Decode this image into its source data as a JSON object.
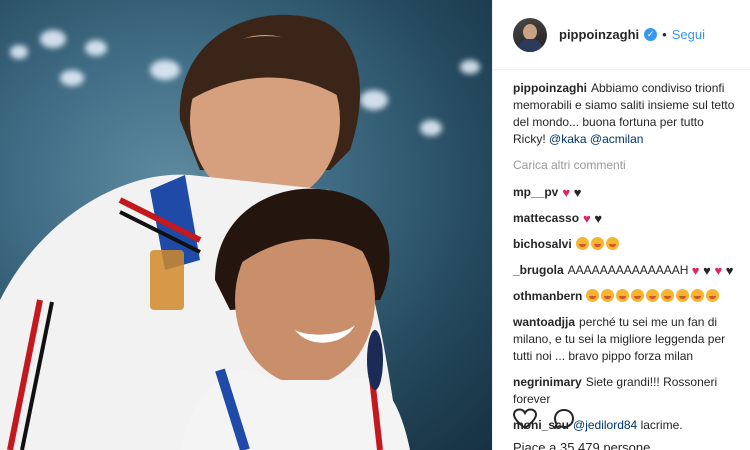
{
  "post": {
    "image_alt": "Two footballers in white AC Milan jackets embracing and smiling",
    "author": "pippoinzaghi",
    "verified": true,
    "follow_label": "Segui",
    "separator": "•"
  },
  "caption": {
    "user": "pippoinzaghi",
    "text": "Abbiamo condiviso trionfi memorabili e siamo saliti insieme sul tetto del mondo... buona fortuna per tutto Ricky!",
    "mentions": [
      "@kaka",
      "@acmilan"
    ]
  },
  "load_more_label": "Carica altri commenti",
  "comments": [
    {
      "user": "mp__pv",
      "text": "",
      "hearts": [
        "red",
        "black"
      ],
      "emojis": 0
    },
    {
      "user": "mattecasso",
      "text": "",
      "hearts": [
        "red",
        "black"
      ],
      "emojis": 0
    },
    {
      "user": "bichosalvi",
      "text": "",
      "hearts": [],
      "emojis": 3
    },
    {
      "user": "_brugola",
      "text": "AAAAAAAAAAAAAAH",
      "hearts": [
        "red",
        "black",
        "red",
        "black"
      ],
      "emojis": 0
    },
    {
      "user": "othmanbern",
      "text": "",
      "hearts": [],
      "emojis": 9
    },
    {
      "user": "wantoadjja",
      "text": "perché tu sei me un fan di milano, e tu sei la migliore leggenda per tutti noi ... bravo pippo forza milan",
      "hearts": [],
      "emojis": 0
    },
    {
      "user": "negrinimary",
      "text": "Siete grandi!!! Rossoneri forever",
      "hearts": [],
      "emojis": 0
    },
    {
      "user": "moni_scu",
      "mention": "@jedilord84",
      "text": "lacrime.",
      "hearts": [],
      "emojis": 0
    }
  ],
  "actions": {
    "like_icon": "heart-outline-icon",
    "comment_icon": "comment-bubble-icon"
  },
  "likes_text": "Piace a 35.479 persone",
  "colors": {
    "link": "#3897f0",
    "mention": "#003569",
    "heart_red": "#e0245e",
    "muted": "#999999"
  }
}
